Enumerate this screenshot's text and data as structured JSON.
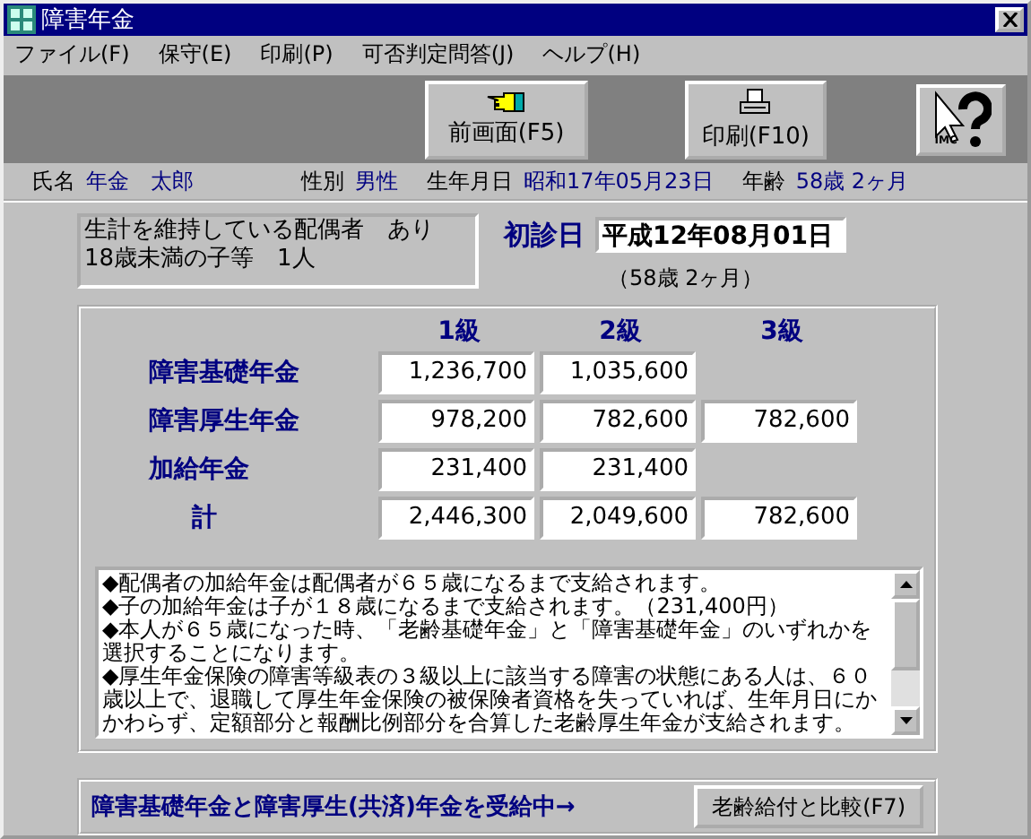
{
  "window": {
    "title": "障害年金"
  },
  "menu": [
    "ファイル(F)",
    "保守(E)",
    "印刷(P)",
    "可否判定問答(J)",
    "ヘルプ(H)"
  ],
  "toolbar": [
    {
      "kind": "back",
      "label": "前画面(F5)"
    },
    {
      "kind": "print",
      "label": "印刷(F10)"
    },
    {
      "kind": "help",
      "label": "IMC"
    }
  ],
  "person": [
    {
      "label": "氏名",
      "value": "年金　太郎"
    },
    {
      "label": "性別",
      "value": "男性"
    },
    {
      "label": "生年月日",
      "value": "昭和17年05月23日"
    },
    {
      "label": "年齢",
      "value": "58歳 2ヶ月"
    }
  ],
  "family": [
    "生計を維持している配偶者　あり",
    "18歳未満の子等　1人"
  ],
  "first_visit": {
    "label": "初診日",
    "value": "平成12年08月01日",
    "age": "（58歳 2ヶ月）"
  },
  "table": {
    "columns": [
      "1級",
      "2級",
      "3級"
    ],
    "rows": [
      {
        "label": "障害基礎年金",
        "cells": [
          "1,236,700",
          "1,035,600",
          null
        ]
      },
      {
        "label": "障害厚生年金",
        "cells": [
          "978,200",
          "782,600",
          "782,600"
        ]
      },
      {
        "label": "加給年金",
        "cells": [
          "231,400",
          "231,400",
          null
        ]
      },
      {
        "label": "計",
        "cells": [
          "2,446,300",
          "2,049,600",
          "782,600"
        ]
      }
    ]
  },
  "notes": [
    "◆配偶者の加給年金は配偶者が６５歳になるまで支給されます。",
    "◆子の加給年金は子が１８歳になるまで支給されます。（231,400円）",
    "◆本人が６５歳になった時、「老齢基礎年金」と「障害基礎年金」のいずれかを選択することになります。",
    "◆厚生年金保険の障害等級表の３級以上に該当する障害の状態にある人は、６０歳以上で、退職して厚生年金保険の被保険者資格を失っていれば、生年月日にかかわらず、定額部分と報酬比例部分を合算した老齢厚生年金が支給されます。"
  ],
  "status": {
    "message": "障害基礎年金と障害厚生(共済)年金を受給中→",
    "button": "老齢給付と比較(F7)"
  }
}
